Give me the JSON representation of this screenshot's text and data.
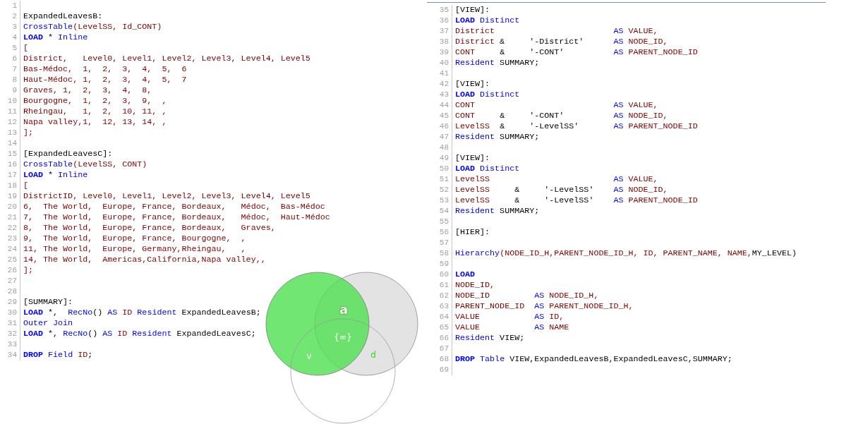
{
  "editors": [
    {
      "lines": [
        {
          "number": "1"
        },
        {
          "number": "2",
          "tokens": [
            {
              "text": "ExpandedLeavesB:",
              "kind": "plain"
            }
          ]
        },
        {
          "number": "3",
          "tokens": [
            {
              "text": "CrossTable",
              "kind": "function"
            },
            {
              "text": "(LevelSS, Id_CONT)",
              "kind": "field"
            }
          ]
        },
        {
          "number": "4",
          "tokens": [
            {
              "text": "LOAD",
              "kind": "keyword"
            },
            {
              "text": " * ",
              "kind": "plain"
            },
            {
              "text": "Inline",
              "kind": "function"
            }
          ]
        },
        {
          "number": "5",
          "tokens": [
            {
              "text": "[",
              "kind": "field"
            }
          ]
        },
        {
          "number": "6",
          "tokens": [
            {
              "text": "District,   Level0, Level1, Level2, Level3, Level4, Level5",
              "kind": "field"
            }
          ]
        },
        {
          "number": "7",
          "tokens": [
            {
              "text": "Bas-Médoc,  1,  2,  3,  4,  5,  6",
              "kind": "field"
            }
          ]
        },
        {
          "number": "8",
          "tokens": [
            {
              "text": "Haut-Médoc, 1,  2,  3,  4,  5,  7",
              "kind": "field"
            }
          ]
        },
        {
          "number": "9",
          "tokens": [
            {
              "text": "Graves, 1,  2,  3,  4,  8,",
              "kind": "field"
            }
          ]
        },
        {
          "number": "10",
          "tokens": [
            {
              "text": "Bourgogne,  1,  2,  3,  9,  ,",
              "kind": "field"
            }
          ]
        },
        {
          "number": "11",
          "tokens": [
            {
              "text": "Rheingau,   1,  2,  10, 11, ,",
              "kind": "field"
            }
          ]
        },
        {
          "number": "12",
          "tokens": [
            {
              "text": "Napa valley,1,  12, 13, 14, ,",
              "kind": "field"
            }
          ]
        },
        {
          "number": "13",
          "tokens": [
            {
              "text": "];",
              "kind": "field"
            }
          ]
        },
        {
          "number": "14"
        },
        {
          "number": "15",
          "tokens": [
            {
              "text": "[ExpandedLeavesC]:",
              "kind": "plain"
            }
          ]
        },
        {
          "number": "16",
          "tokens": [
            {
              "text": "CrossTable",
              "kind": "function"
            },
            {
              "text": "(LevelSS, CONT)",
              "kind": "field"
            }
          ]
        },
        {
          "number": "17",
          "tokens": [
            {
              "text": "LOAD",
              "kind": "keyword"
            },
            {
              "text": " * ",
              "kind": "plain"
            },
            {
              "text": "Inline",
              "kind": "function"
            }
          ]
        },
        {
          "number": "18",
          "tokens": [
            {
              "text": "[",
              "kind": "field"
            }
          ]
        },
        {
          "number": "19",
          "tokens": [
            {
              "text": "DistrictID, Level0, Level1, Level2, Level3, Level4, Level5",
              "kind": "field"
            }
          ]
        },
        {
          "number": "20",
          "tokens": [
            {
              "text": "6,  The World,  Europe, France, Bordeaux,   Médoc,  Bas-Médoc",
              "kind": "field"
            }
          ]
        },
        {
          "number": "21",
          "tokens": [
            {
              "text": "7,  The World,  Europe, France, Bordeaux,   Médoc,  Haut-Médoc",
              "kind": "field"
            }
          ]
        },
        {
          "number": "22",
          "tokens": [
            {
              "text": "8,  The World,  Europe, France, Bordeaux,   Graves,",
              "kind": "field"
            }
          ]
        },
        {
          "number": "23",
          "tokens": [
            {
              "text": "9,  The World,  Europe, France, Bourgogne,  ,",
              "kind": "field"
            }
          ]
        },
        {
          "number": "24",
          "tokens": [
            {
              "text": "11, The World,  Europe, Germany,Rheingau,   ,",
              "kind": "field"
            }
          ]
        },
        {
          "number": "25",
          "tokens": [
            {
              "text": "14, The World,  Americas,California,Napa valley,,",
              "kind": "field"
            }
          ]
        },
        {
          "number": "26",
          "tokens": [
            {
              "text": "];",
              "kind": "field"
            }
          ]
        },
        {
          "number": "27"
        },
        {
          "number": "28"
        },
        {
          "number": "29",
          "tokens": [
            {
              "text": "[SUMMARY]:",
              "kind": "plain"
            }
          ]
        },
        {
          "number": "30",
          "tokens": [
            {
              "text": "LOAD",
              "kind": "keyword"
            },
            {
              "text": " *,  ",
              "kind": "plain"
            },
            {
              "text": "RecNo",
              "kind": "function"
            },
            {
              "text": "() ",
              "kind": "plain"
            },
            {
              "text": "AS",
              "kind": "function"
            },
            {
              "text": " ID",
              "kind": "field"
            },
            {
              "text": " Resident",
              "kind": "function"
            },
            {
              "text": " ExpandedLeavesB;",
              "kind": "plain"
            }
          ]
        },
        {
          "number": "31",
          "tokens": [
            {
              "text": "Outer Join",
              "kind": "function"
            }
          ]
        },
        {
          "number": "32",
          "tokens": [
            {
              "text": "LOAD",
              "kind": "keyword"
            },
            {
              "text": " *, ",
              "kind": "plain"
            },
            {
              "text": "RecNo",
              "kind": "function"
            },
            {
              "text": "() ",
              "kind": "plain"
            },
            {
              "text": "AS",
              "kind": "function"
            },
            {
              "text": " ID",
              "kind": "field"
            },
            {
              "text": " Resident",
              "kind": "function"
            },
            {
              "text": " ExpandedLeavesC;",
              "kind": "plain"
            }
          ]
        },
        {
          "number": "33"
        },
        {
          "number": "34",
          "tokens": [
            {
              "text": "DROP",
              "kind": "keyword"
            },
            {
              "text": " Field",
              "kind": "function"
            },
            {
              "text": " ID",
              "kind": "field"
            },
            {
              "text": ";",
              "kind": "plain"
            }
          ]
        }
      ]
    },
    {
      "lines": [
        {
          "number": "35",
          "tokens": [
            {
              "text": "[VIEW]:",
              "kind": "plain"
            }
          ]
        },
        {
          "number": "36",
          "tokens": [
            {
              "text": "LOAD",
              "kind": "keyword"
            },
            {
              "text": " Distinct",
              "kind": "function"
            }
          ]
        },
        {
          "number": "37",
          "tokens": [
            {
              "text": "District                        ",
              "kind": "field"
            },
            {
              "text": "AS",
              "kind": "function"
            },
            {
              "text": " VALUE,",
              "kind": "field"
            }
          ]
        },
        {
          "number": "38",
          "tokens": [
            {
              "text": "District",
              "kind": "field"
            },
            {
              "text": " &     '-District'      ",
              "kind": "plain"
            },
            {
              "text": "AS",
              "kind": "function"
            },
            {
              "text": " NODE_ID,",
              "kind": "field"
            }
          ]
        },
        {
          "number": "39",
          "tokens": [
            {
              "text": "CONT",
              "kind": "field"
            },
            {
              "text": "     &     '-CONT'          ",
              "kind": "plain"
            },
            {
              "text": "AS",
              "kind": "function"
            },
            {
              "text": " PARENT_NODE_ID",
              "kind": "field"
            }
          ]
        },
        {
          "number": "40",
          "tokens": [
            {
              "text": "Resident",
              "kind": "function"
            },
            {
              "text": " SUMMARY;",
              "kind": "plain"
            }
          ]
        },
        {
          "number": "41"
        },
        {
          "number": "42",
          "tokens": [
            {
              "text": "[VIEW]:",
              "kind": "plain"
            }
          ]
        },
        {
          "number": "43",
          "tokens": [
            {
              "text": "LOAD",
              "kind": "keyword"
            },
            {
              "text": " Distinct",
              "kind": "function"
            }
          ]
        },
        {
          "number": "44",
          "tokens": [
            {
              "text": "CONT                            ",
              "kind": "field"
            },
            {
              "text": "AS",
              "kind": "function"
            },
            {
              "text": " VALUE,",
              "kind": "field"
            }
          ]
        },
        {
          "number": "45",
          "tokens": [
            {
              "text": "CONT",
              "kind": "field"
            },
            {
              "text": "     &     '-CONT'          ",
              "kind": "plain"
            },
            {
              "text": "AS",
              "kind": "function"
            },
            {
              "text": " NODE_ID,",
              "kind": "field"
            }
          ]
        },
        {
          "number": "46",
          "tokens": [
            {
              "text": "LevelSS",
              "kind": "field"
            },
            {
              "text": "  &     '-LevelSS'       ",
              "kind": "plain"
            },
            {
              "text": "AS",
              "kind": "function"
            },
            {
              "text": " PARENT_NODE_ID",
              "kind": "field"
            }
          ]
        },
        {
          "number": "47",
          "tokens": [
            {
              "text": "Resident",
              "kind": "function"
            },
            {
              "text": " SUMMARY;",
              "kind": "plain"
            }
          ]
        },
        {
          "number": "48"
        },
        {
          "number": "49",
          "tokens": [
            {
              "text": "[VIEW]:",
              "kind": "plain"
            }
          ]
        },
        {
          "number": "50",
          "tokens": [
            {
              "text": "LOAD",
              "kind": "keyword"
            },
            {
              "text": " Distinct",
              "kind": "function"
            }
          ]
        },
        {
          "number": "51",
          "tokens": [
            {
              "text": "LevelSS                         ",
              "kind": "field"
            },
            {
              "text": "AS",
              "kind": "function"
            },
            {
              "text": " VALUE,",
              "kind": "field"
            }
          ]
        },
        {
          "number": "52",
          "tokens": [
            {
              "text": "LevelSS",
              "kind": "field"
            },
            {
              "text": "     &     '-LevelSS'    ",
              "kind": "plain"
            },
            {
              "text": "AS",
              "kind": "function"
            },
            {
              "text": " NODE_ID,",
              "kind": "field"
            }
          ]
        },
        {
          "number": "53",
          "tokens": [
            {
              "text": "LevelSS",
              "kind": "field"
            },
            {
              "text": "     &     '-LevelSS'    ",
              "kind": "plain"
            },
            {
              "text": "AS",
              "kind": "function"
            },
            {
              "text": " PARENT_NODE_ID",
              "kind": "field"
            }
          ]
        },
        {
          "number": "54",
          "tokens": [
            {
              "text": "Resident",
              "kind": "function"
            },
            {
              "text": " SUMMARY;",
              "kind": "plain"
            }
          ]
        },
        {
          "number": "55"
        },
        {
          "number": "56",
          "tokens": [
            {
              "text": "[HIER]:",
              "kind": "plain"
            }
          ]
        },
        {
          "number": "57"
        },
        {
          "number": "58",
          "tokens": [
            {
              "text": "Hierarchy",
              "kind": "function"
            },
            {
              "text": "(NODE_ID_H,PARENT_NODE_ID_H, ID, PARENT_NAME, NAME,",
              "kind": "field"
            },
            {
              "text": "MY_LEVEL)",
              "kind": "plain"
            }
          ]
        },
        {
          "number": "59"
        },
        {
          "number": "60",
          "tokens": [
            {
              "text": "LOAD",
              "kind": "keyword"
            }
          ]
        },
        {
          "number": "61",
          "tokens": [
            {
              "text": "NODE_ID,",
              "kind": "field"
            }
          ]
        },
        {
          "number": "62",
          "tokens": [
            {
              "text": "NODE_ID         ",
              "kind": "field"
            },
            {
              "text": "AS",
              "kind": "function"
            },
            {
              "text": " NODE_ID_H,",
              "kind": "field"
            }
          ]
        },
        {
          "number": "63",
          "tokens": [
            {
              "text": "PARENT_NODE_ID  ",
              "kind": "field"
            },
            {
              "text": "AS",
              "kind": "function"
            },
            {
              "text": " PARENT_NODE_ID_H,",
              "kind": "field"
            }
          ]
        },
        {
          "number": "64",
          "tokens": [
            {
              "text": "VALUE           ",
              "kind": "field"
            },
            {
              "text": "AS",
              "kind": "function"
            },
            {
              "text": " ID,",
              "kind": "field"
            }
          ]
        },
        {
          "number": "65",
          "tokens": [
            {
              "text": "VALUE           ",
              "kind": "field"
            },
            {
              "text": "AS",
              "kind": "function"
            },
            {
              "text": " NAME",
              "kind": "field"
            }
          ]
        },
        {
          "number": "66",
          "tokens": [
            {
              "text": "Resident",
              "kind": "function"
            },
            {
              "text": " VIEW;",
              "kind": "plain"
            }
          ]
        },
        {
          "number": "67"
        },
        {
          "number": "68",
          "tokens": [
            {
              "text": "DROP",
              "kind": "keyword"
            },
            {
              "text": " Table",
              "kind": "function"
            },
            {
              "text": " VIEW,ExpandedLeavesB,ExpandedLeavesC,SUMMARY;",
              "kind": "plain"
            }
          ]
        },
        {
          "number": "69"
        }
      ]
    }
  ],
  "venn": {
    "labels": [
      {
        "text": "a",
        "color": "#f2f2f2"
      },
      {
        "text": "{∞}",
        "color": "#ffffff"
      },
      {
        "text": "v",
        "color": "#ffffff"
      },
      {
        "text": "d",
        "color": "#22dd22"
      }
    ]
  }
}
